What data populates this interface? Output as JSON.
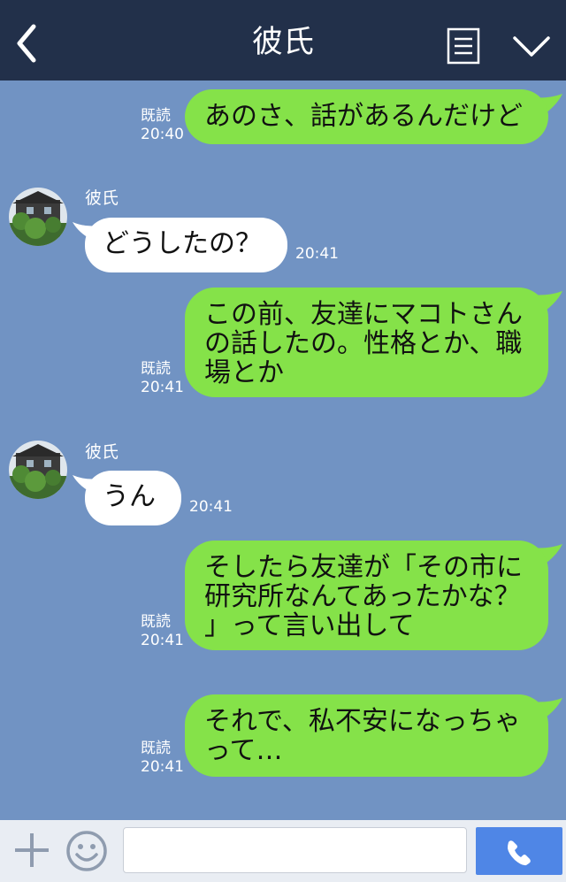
{
  "header": {
    "title": "彼氏",
    "back_icon": "chevron-left-icon",
    "menu_icon": "list-icon",
    "collapse_icon": "chevron-down-icon"
  },
  "colors": {
    "header_bg": "#22304a",
    "chat_bg": "#7193c3",
    "sent_bubble": "#85e249",
    "received_bubble": "#ffffff",
    "send_button": "#4f86e6"
  },
  "messages": [
    {
      "side": "right",
      "text": "あのさ、話があるんだけど",
      "read": "既読",
      "time": "20:40"
    },
    {
      "side": "left",
      "sender": "彼氏",
      "text": "どうしたの？",
      "time": "20:41"
    },
    {
      "side": "right",
      "lines": [
        "この前、友達にマコトさん",
        "の話したの。性格とか、職",
        "場とか"
      ],
      "read": "既読",
      "time": "20:41"
    },
    {
      "side": "left",
      "sender": "彼氏",
      "text": "うん",
      "time": "20:41"
    },
    {
      "side": "right",
      "lines": [
        "そしたら友達が「その市に",
        "研究所なんてあったかな？",
        "」って言い出して"
      ],
      "read": "既読",
      "time": "20:41"
    },
    {
      "side": "right",
      "lines": [
        "それで、私不安になっちゃ",
        "って…"
      ],
      "read": "既読",
      "time": "20:41"
    }
  ],
  "input_bar": {
    "plus_icon": "plus-icon",
    "emoji_icon": "smiley-icon",
    "message_value": "",
    "call_icon": "phone-icon"
  }
}
